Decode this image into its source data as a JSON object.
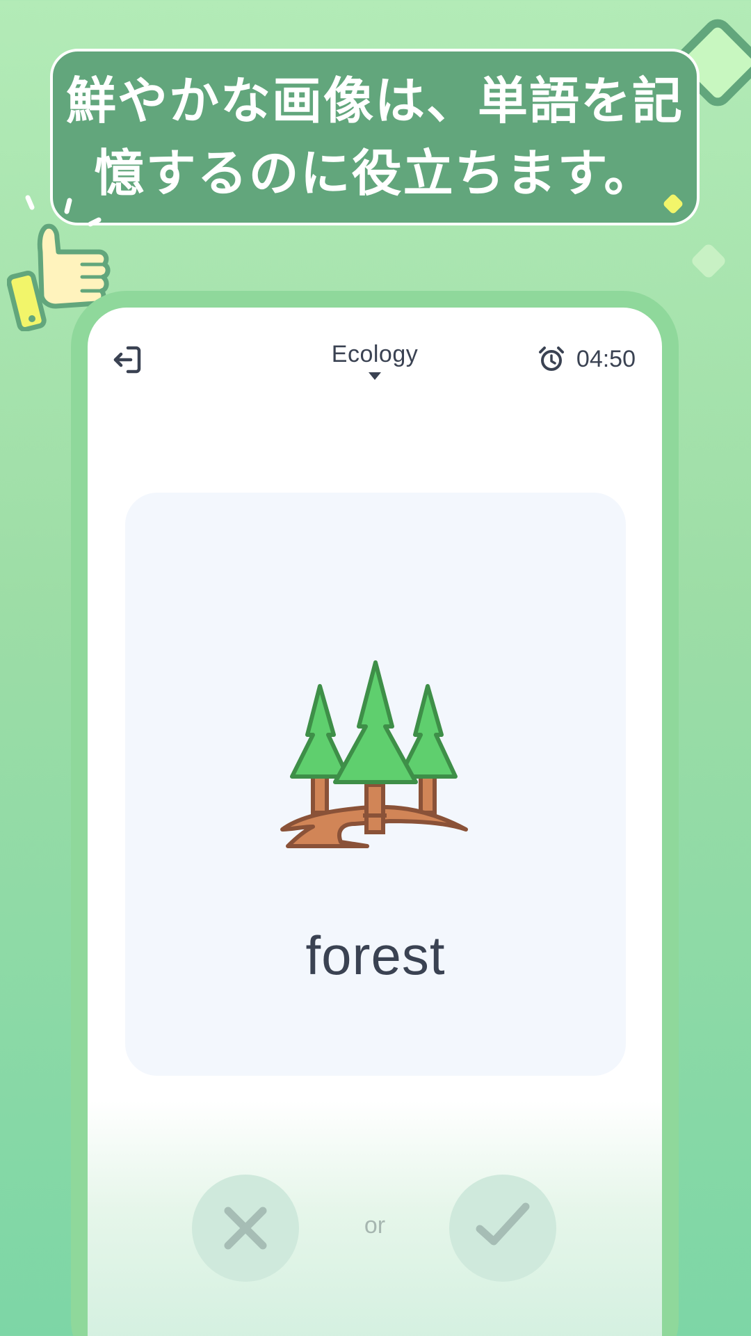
{
  "banner": {
    "line1": "鮮やかな画像は、単語を記",
    "line2": "憶するのに役立ちます。"
  },
  "top_bar": {
    "exit_icon": "exit-icon",
    "category": "Ecology",
    "timer_icon": "alarm-clock-icon",
    "timer": "04:50"
  },
  "card": {
    "illustration": "forest-icon",
    "word": "forest"
  },
  "answers": {
    "wrong_icon": "x-icon",
    "or_label": "or",
    "right_icon": "check-icon"
  },
  "colors": {
    "banner_bg": "#62a67c",
    "text_dark": "#3a4252",
    "card_bg": "#f3f7fd",
    "tree_green": "#5fcf6e",
    "trunk_brown": "#d18557"
  }
}
